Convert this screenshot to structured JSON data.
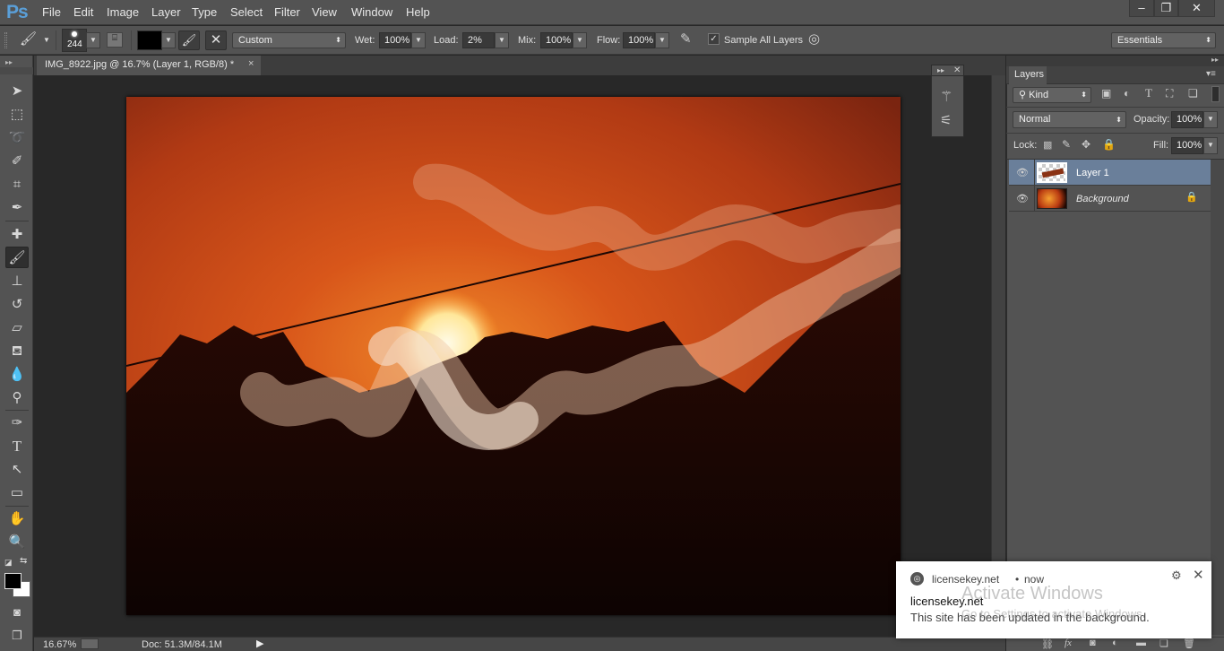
{
  "app": {
    "logo": "Ps"
  },
  "menu": [
    "File",
    "Edit",
    "Image",
    "Layer",
    "Type",
    "Select",
    "Filter",
    "View",
    "Window",
    "Help"
  ],
  "window_controls": {
    "minimize": "–",
    "restore": "❐",
    "close": "✕"
  },
  "options": {
    "brush_size": "244",
    "preset": "Custom",
    "wet_label": "Wet:",
    "wet": "100%",
    "load_label": "Load:",
    "load": "2%",
    "mix_label": "Mix:",
    "mix": "100%",
    "flow_label": "Flow:",
    "flow": "100%",
    "sample_all_label": "Sample All Layers",
    "sample_all_checked": true,
    "workspace": "Essentials",
    "foreground_color": "#000000"
  },
  "document": {
    "tab_title": "IMG_8922.jpg @ 16.7% (Layer 1, RGB/8) *",
    "close": "×"
  },
  "status": {
    "zoom": "16.67%",
    "doc": "Doc: 51.3M/84.1M"
  },
  "layers_panel": {
    "title": "Layers",
    "filter_kind": "Kind",
    "blend_mode": "Normal",
    "opacity_label": "Opacity:",
    "opacity": "100%",
    "lock_label": "Lock:",
    "fill_label": "Fill:",
    "fill": "100%",
    "layers": [
      {
        "name": "Layer 1",
        "visible": true,
        "selected": true,
        "locked": false
      },
      {
        "name": "Background",
        "visible": true,
        "selected": false,
        "locked": true
      }
    ]
  },
  "notification": {
    "source": "licensekey.net",
    "time": "now",
    "title": "licensekey.net",
    "message": "This site has been updated in the background."
  },
  "watermark": {
    "line1": "Activate Windows",
    "line2": "Go to Settings to activate Windows."
  },
  "colors": {
    "accent_selected_layer": "#6a7f9a",
    "logo": "#5a9fd8"
  }
}
